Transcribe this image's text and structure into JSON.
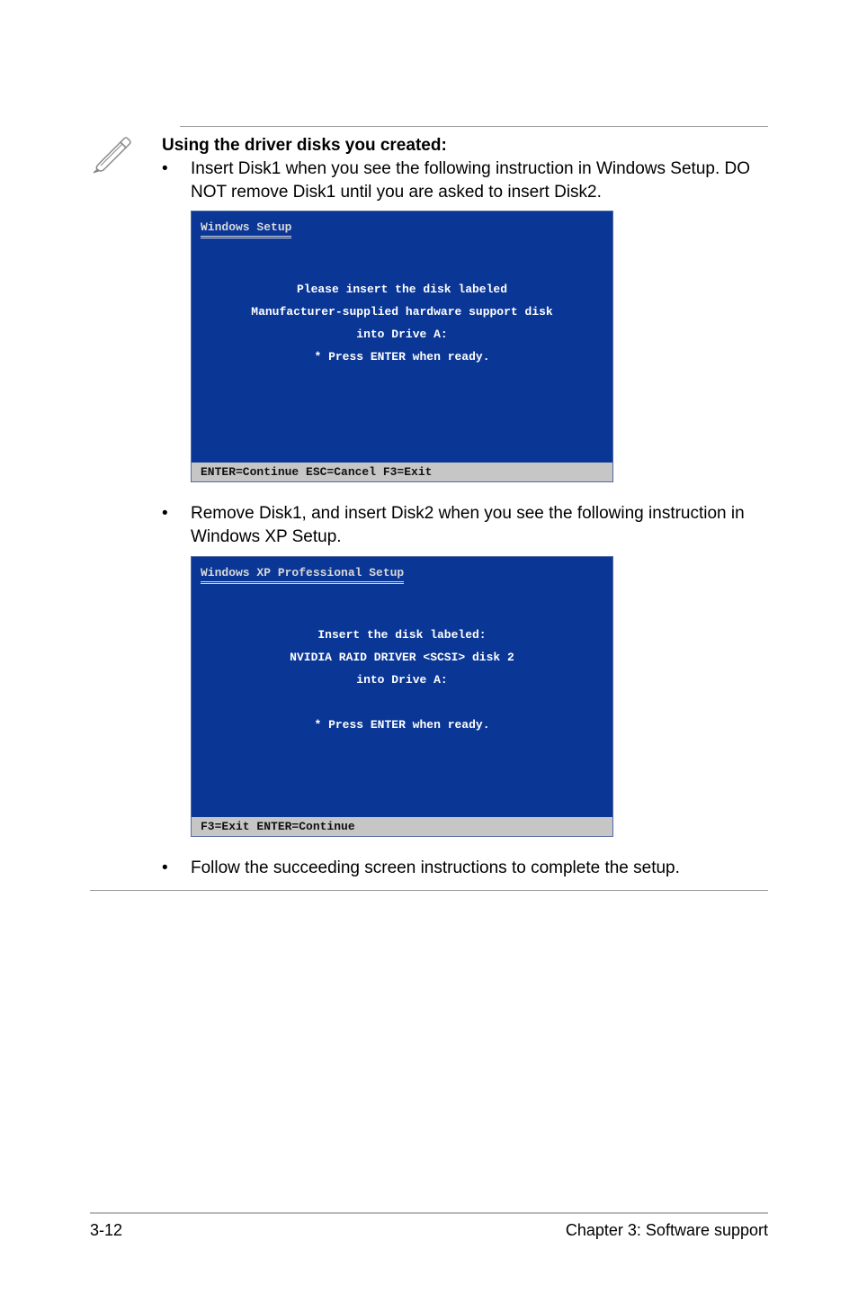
{
  "note": {
    "heading": "Using the driver disks you created:",
    "bullet1": "Insert Disk1 when you see the following instruction in Windows Setup. DO NOT remove Disk1 until you are asked to insert Disk2.",
    "bullet2": "Remove Disk1, and insert Disk2 when you see the following instruction in Windows XP Setup.",
    "bullet3": "Follow the succeeding screen instructions to complete the setup."
  },
  "screen1": {
    "title": "Windows Setup",
    "line1": "Please insert the disk labeled",
    "line2": "Manufacturer-supplied hardware support disk",
    "line3": "into Drive A:",
    "line4": "*  Press ENTER when ready.",
    "footer": "  ENTER=Continue   ESC=Cancel   F3=Exit"
  },
  "screen2": {
    "title": "Windows XP Professional Setup",
    "line1": "Insert the disk labeled:",
    "line2": "NVIDIA RAID DRIVER <SCSI> disk 2",
    "line3": "into Drive A:",
    "line4": "*  Press ENTER when ready.",
    "footer": "  F3=Exit   ENTER=Continue"
  },
  "footer": {
    "left": "3-12",
    "right": "Chapter 3: Software support"
  }
}
